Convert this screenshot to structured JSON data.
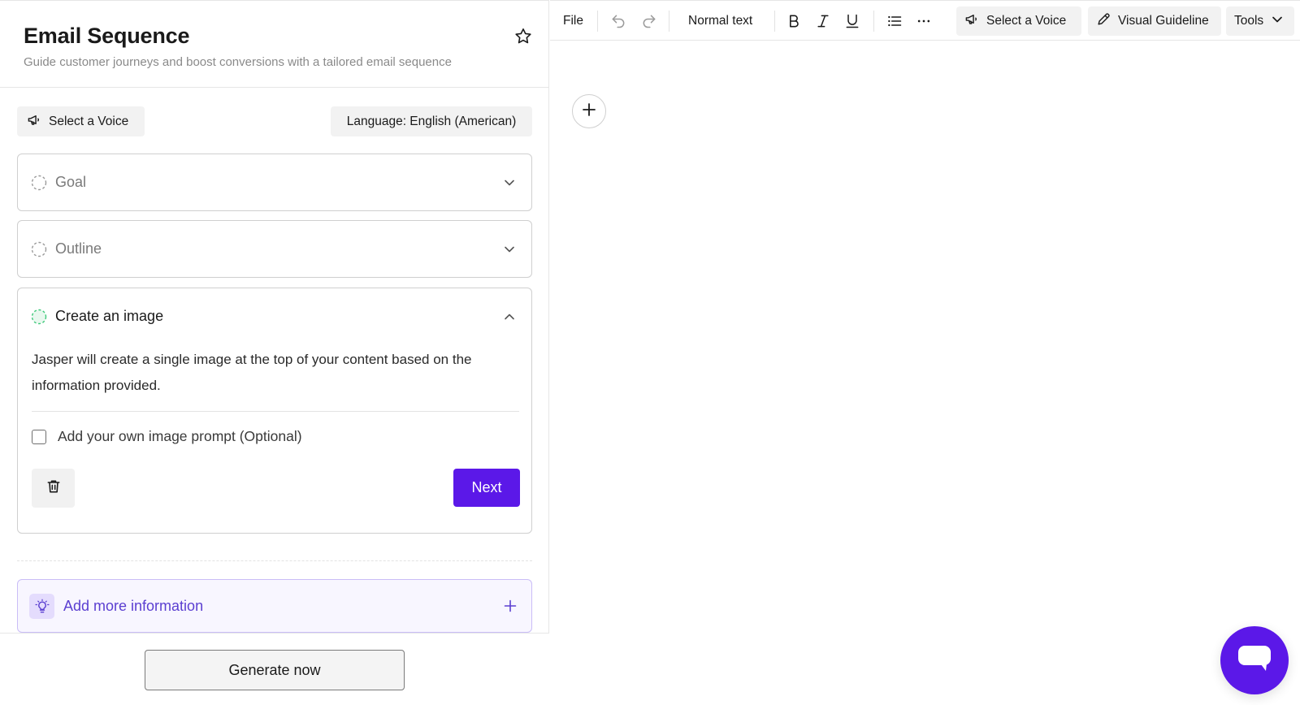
{
  "panel": {
    "title": "Email Sequence",
    "subtitle": "Guide customer journeys and boost conversions with a tailored email sequence",
    "voice_label": "Select a Voice",
    "language_label": "Language: English (American)"
  },
  "steps": [
    {
      "label": "Goal",
      "state": "collapsed"
    },
    {
      "label": "Outline",
      "state": "collapsed"
    },
    {
      "label": "Create an image",
      "state": "expanded",
      "description": "Jasper will create a single image at the top of your content based on the information provided.",
      "checkbox_label": "Add your own image prompt (Optional)",
      "checkbox_checked": false,
      "next_label": "Next"
    }
  ],
  "more_info_label": "Add more information",
  "generate_label": "Generate now",
  "toolbar": {
    "file": "File",
    "text_style": "Normal text",
    "voice": "Select a Voice",
    "visual_guideline": "Visual Guideline",
    "tools": "Tools"
  },
  "colors": {
    "accent": "#5b18e8",
    "info_border": "#cabdf7",
    "info_text": "#5b3fd1",
    "step_active": "#3ec97a"
  },
  "icons": [
    "star-icon",
    "megaphone-icon",
    "chevron-down-icon",
    "chevron-up-icon",
    "trash-icon",
    "lightbulb-icon",
    "plus-icon",
    "undo-icon",
    "redo-icon",
    "bold-icon",
    "italic-icon",
    "underline-icon",
    "list-icon",
    "more-icon",
    "pen-icon",
    "chat-icon"
  ]
}
